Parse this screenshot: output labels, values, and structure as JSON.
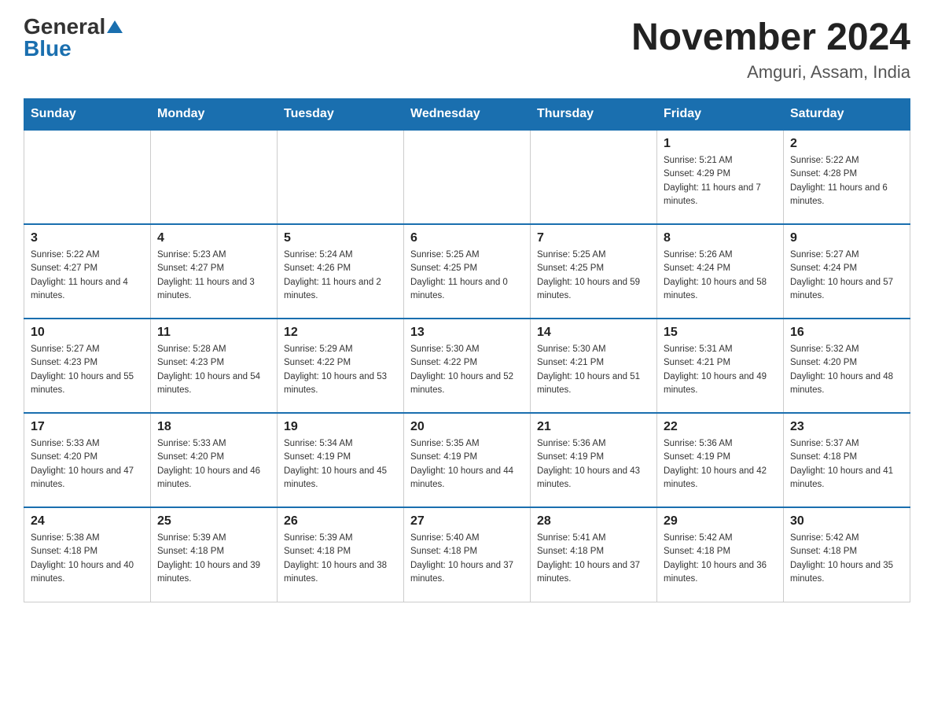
{
  "header": {
    "logo_general": "General",
    "logo_blue": "Blue",
    "title": "November 2024",
    "subtitle": "Amguri, Assam, India"
  },
  "weekdays": [
    "Sunday",
    "Monday",
    "Tuesday",
    "Wednesday",
    "Thursday",
    "Friday",
    "Saturday"
  ],
  "weeks": [
    [
      {
        "day": "",
        "info": ""
      },
      {
        "day": "",
        "info": ""
      },
      {
        "day": "",
        "info": ""
      },
      {
        "day": "",
        "info": ""
      },
      {
        "day": "",
        "info": ""
      },
      {
        "day": "1",
        "info": "Sunrise: 5:21 AM\nSunset: 4:29 PM\nDaylight: 11 hours and 7 minutes."
      },
      {
        "day": "2",
        "info": "Sunrise: 5:22 AM\nSunset: 4:28 PM\nDaylight: 11 hours and 6 minutes."
      }
    ],
    [
      {
        "day": "3",
        "info": "Sunrise: 5:22 AM\nSunset: 4:27 PM\nDaylight: 11 hours and 4 minutes."
      },
      {
        "day": "4",
        "info": "Sunrise: 5:23 AM\nSunset: 4:27 PM\nDaylight: 11 hours and 3 minutes."
      },
      {
        "day": "5",
        "info": "Sunrise: 5:24 AM\nSunset: 4:26 PM\nDaylight: 11 hours and 2 minutes."
      },
      {
        "day": "6",
        "info": "Sunrise: 5:25 AM\nSunset: 4:25 PM\nDaylight: 11 hours and 0 minutes."
      },
      {
        "day": "7",
        "info": "Sunrise: 5:25 AM\nSunset: 4:25 PM\nDaylight: 10 hours and 59 minutes."
      },
      {
        "day": "8",
        "info": "Sunrise: 5:26 AM\nSunset: 4:24 PM\nDaylight: 10 hours and 58 minutes."
      },
      {
        "day": "9",
        "info": "Sunrise: 5:27 AM\nSunset: 4:24 PM\nDaylight: 10 hours and 57 minutes."
      }
    ],
    [
      {
        "day": "10",
        "info": "Sunrise: 5:27 AM\nSunset: 4:23 PM\nDaylight: 10 hours and 55 minutes."
      },
      {
        "day": "11",
        "info": "Sunrise: 5:28 AM\nSunset: 4:23 PM\nDaylight: 10 hours and 54 minutes."
      },
      {
        "day": "12",
        "info": "Sunrise: 5:29 AM\nSunset: 4:22 PM\nDaylight: 10 hours and 53 minutes."
      },
      {
        "day": "13",
        "info": "Sunrise: 5:30 AM\nSunset: 4:22 PM\nDaylight: 10 hours and 52 minutes."
      },
      {
        "day": "14",
        "info": "Sunrise: 5:30 AM\nSunset: 4:21 PM\nDaylight: 10 hours and 51 minutes."
      },
      {
        "day": "15",
        "info": "Sunrise: 5:31 AM\nSunset: 4:21 PM\nDaylight: 10 hours and 49 minutes."
      },
      {
        "day": "16",
        "info": "Sunrise: 5:32 AM\nSunset: 4:20 PM\nDaylight: 10 hours and 48 minutes."
      }
    ],
    [
      {
        "day": "17",
        "info": "Sunrise: 5:33 AM\nSunset: 4:20 PM\nDaylight: 10 hours and 47 minutes."
      },
      {
        "day": "18",
        "info": "Sunrise: 5:33 AM\nSunset: 4:20 PM\nDaylight: 10 hours and 46 minutes."
      },
      {
        "day": "19",
        "info": "Sunrise: 5:34 AM\nSunset: 4:19 PM\nDaylight: 10 hours and 45 minutes."
      },
      {
        "day": "20",
        "info": "Sunrise: 5:35 AM\nSunset: 4:19 PM\nDaylight: 10 hours and 44 minutes."
      },
      {
        "day": "21",
        "info": "Sunrise: 5:36 AM\nSunset: 4:19 PM\nDaylight: 10 hours and 43 minutes."
      },
      {
        "day": "22",
        "info": "Sunrise: 5:36 AM\nSunset: 4:19 PM\nDaylight: 10 hours and 42 minutes."
      },
      {
        "day": "23",
        "info": "Sunrise: 5:37 AM\nSunset: 4:18 PM\nDaylight: 10 hours and 41 minutes."
      }
    ],
    [
      {
        "day": "24",
        "info": "Sunrise: 5:38 AM\nSunset: 4:18 PM\nDaylight: 10 hours and 40 minutes."
      },
      {
        "day": "25",
        "info": "Sunrise: 5:39 AM\nSunset: 4:18 PM\nDaylight: 10 hours and 39 minutes."
      },
      {
        "day": "26",
        "info": "Sunrise: 5:39 AM\nSunset: 4:18 PM\nDaylight: 10 hours and 38 minutes."
      },
      {
        "day": "27",
        "info": "Sunrise: 5:40 AM\nSunset: 4:18 PM\nDaylight: 10 hours and 37 minutes."
      },
      {
        "day": "28",
        "info": "Sunrise: 5:41 AM\nSunset: 4:18 PM\nDaylight: 10 hours and 37 minutes."
      },
      {
        "day": "29",
        "info": "Sunrise: 5:42 AM\nSunset: 4:18 PM\nDaylight: 10 hours and 36 minutes."
      },
      {
        "day": "30",
        "info": "Sunrise: 5:42 AM\nSunset: 4:18 PM\nDaylight: 10 hours and 35 minutes."
      }
    ]
  ]
}
